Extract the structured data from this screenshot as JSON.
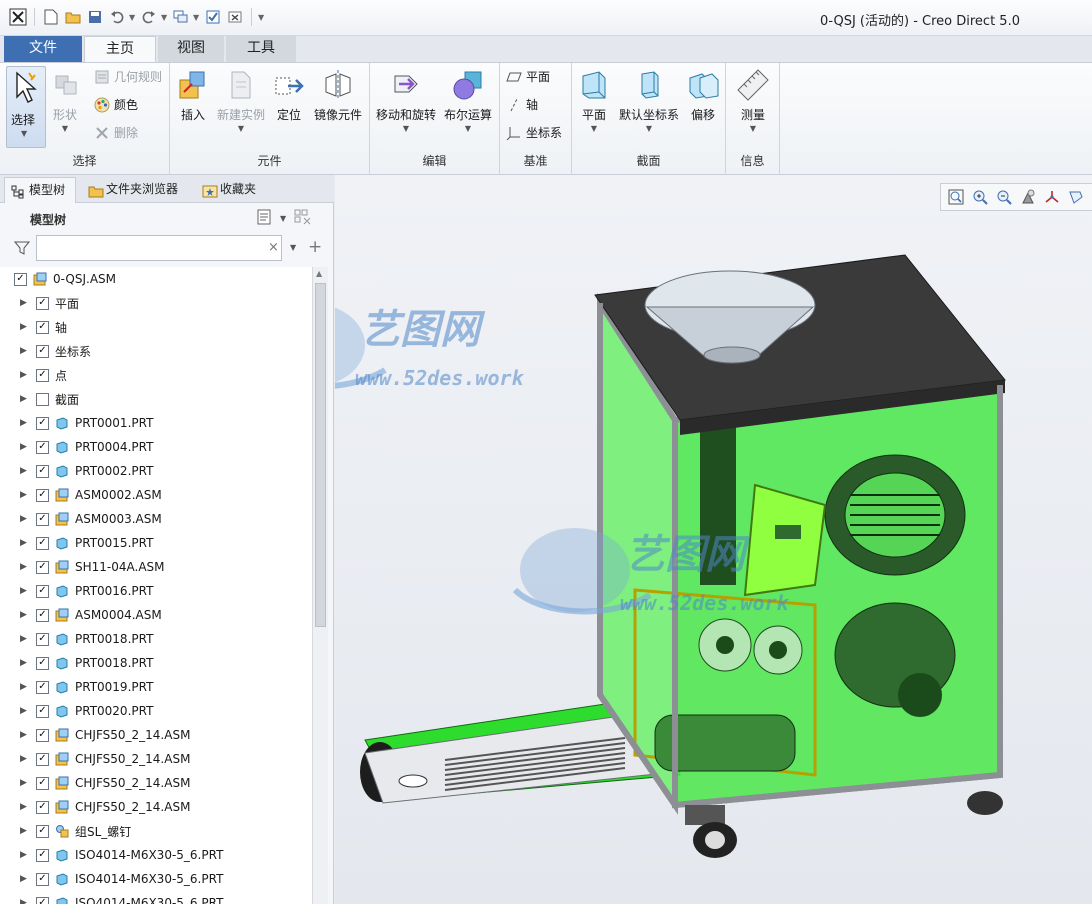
{
  "window": {
    "title": "0-QSJ (活动的) - Creo Direct 5.0"
  },
  "tabs": {
    "file": "文件",
    "home": "主页",
    "view": "视图",
    "tools": "工具"
  },
  "ribbon": {
    "select": {
      "label": "选择",
      "group": "选择",
      "shape": "形状",
      "geometry_rule": "几何规则",
      "color": "颜色",
      "delete": "删除"
    },
    "component": {
      "group": "元件",
      "insert": "插入",
      "new_instance": "新建实例",
      "position": "定位",
      "mirror": "镜像元件"
    },
    "edit": {
      "group": "编辑",
      "move_rotate": "移动和旋转",
      "boolean": "布尔运算"
    },
    "datum": {
      "group": "基准",
      "plane": "平面",
      "axis": "轴",
      "csys": "坐标系"
    },
    "section": {
      "group": "截面",
      "plane": "平面",
      "default_csys": "默认坐标系",
      "offset": "偏移"
    },
    "info": {
      "group": "信息",
      "measure": "测量"
    }
  },
  "panel": {
    "tabs": {
      "model_tree": "模型树",
      "folder_browser": "文件夹浏览器",
      "favorites": "收藏夹"
    },
    "tree_title": "模型树",
    "filter_placeholder": "",
    "items": [
      {
        "label": "0-QSJ.ASM",
        "type": "asm",
        "checked": true,
        "root": true
      },
      {
        "label": "平面",
        "type": "none",
        "checked": true
      },
      {
        "label": "轴",
        "type": "none",
        "checked": true
      },
      {
        "label": "坐标系",
        "type": "none",
        "checked": true
      },
      {
        "label": "点",
        "type": "none",
        "checked": true
      },
      {
        "label": "截面",
        "type": "none",
        "checked": false
      },
      {
        "label": "PRT0001.PRT",
        "type": "prt",
        "checked": true
      },
      {
        "label": "PRT0004.PRT",
        "type": "prt",
        "checked": true
      },
      {
        "label": "PRT0002.PRT",
        "type": "prt",
        "checked": true
      },
      {
        "label": "ASM0002.ASM",
        "type": "asm",
        "checked": true
      },
      {
        "label": "ASM0003.ASM",
        "type": "asm",
        "checked": true
      },
      {
        "label": "PRT0015.PRT",
        "type": "prt",
        "checked": true
      },
      {
        "label": "SH11-04A.ASM",
        "type": "asm",
        "checked": true
      },
      {
        "label": "PRT0016.PRT",
        "type": "prt",
        "checked": true
      },
      {
        "label": "ASM0004.ASM",
        "type": "asm",
        "checked": true
      },
      {
        "label": "PRT0018.PRT",
        "type": "prt",
        "checked": true
      },
      {
        "label": "PRT0018.PRT",
        "type": "prt",
        "checked": true
      },
      {
        "label": "PRT0019.PRT",
        "type": "prt",
        "checked": true
      },
      {
        "label": "PRT0020.PRT",
        "type": "prt",
        "checked": true
      },
      {
        "label": "CHJFS50_2_14.ASM",
        "type": "asm",
        "checked": true
      },
      {
        "label": "CHJFS50_2_14.ASM",
        "type": "asm",
        "checked": true
      },
      {
        "label": "CHJFS50_2_14.ASM",
        "type": "asm",
        "checked": true
      },
      {
        "label": "CHJFS50_2_14.ASM",
        "type": "asm",
        "checked": true
      },
      {
        "label": "组SL_螺钉",
        "type": "grp",
        "checked": true
      },
      {
        "label": "ISO4014-M6X30-5_6.PRT",
        "type": "prt",
        "checked": true
      },
      {
        "label": "ISO4014-M6X30-5_6.PRT",
        "type": "prt",
        "checked": true
      },
      {
        "label": "ISO4014-M6X30-5_6.PRT",
        "type": "prt",
        "checked": true
      }
    ]
  },
  "watermark": {
    "brand": "艺图网",
    "url": "www.52des.work"
  },
  "colors": {
    "accent": "#3d6fb2",
    "glass": "#33e633",
    "frame": "#8c8f94"
  }
}
